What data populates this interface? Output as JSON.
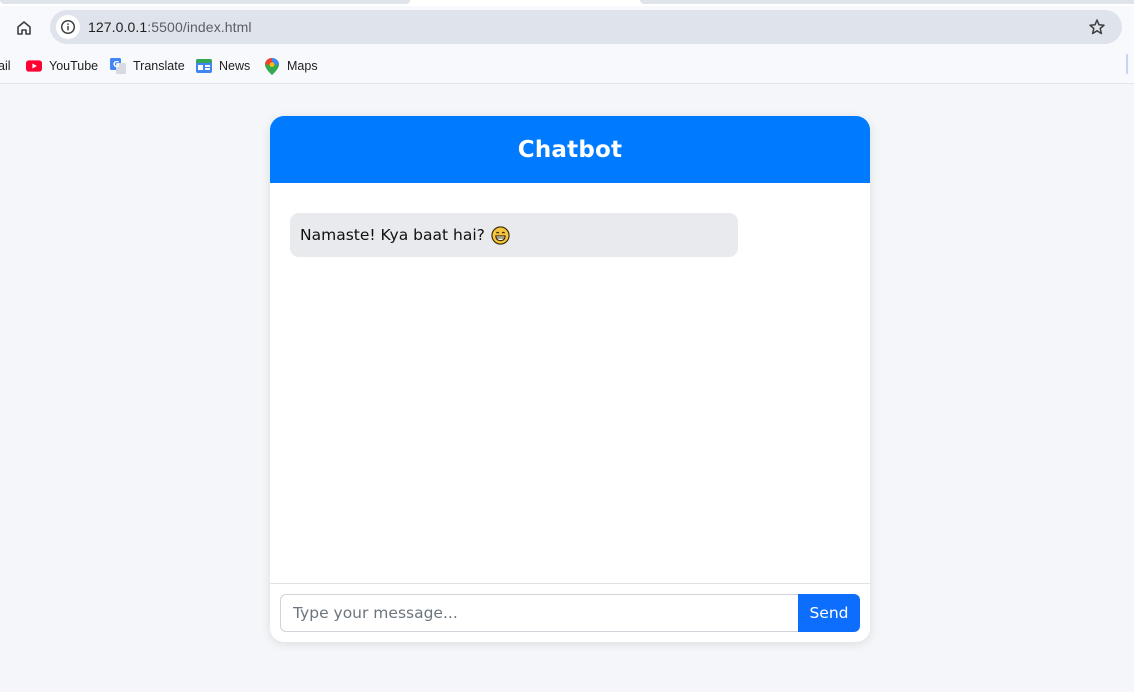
{
  "browser": {
    "url_host": "127.0.0.1",
    "url_path": ":5500/index.html",
    "bookmarks": [
      {
        "label": "ail",
        "icon": "gmail-icon"
      },
      {
        "label": "YouTube",
        "icon": "youtube-icon"
      },
      {
        "label": "Translate",
        "icon": "translate-icon"
      },
      {
        "label": "News",
        "icon": "news-icon"
      },
      {
        "label": "Maps",
        "icon": "maps-icon"
      }
    ]
  },
  "chat": {
    "title": "Chatbot",
    "messages": [
      {
        "sender": "bot",
        "text": "Namaste! Kya baat hai?",
        "emoji": "grinning-face-icon"
      }
    ],
    "input_placeholder": "Type your message...",
    "input_value": "",
    "send_label": "Send"
  },
  "colors": {
    "header": "#007bff",
    "send_button": "#0d6efd",
    "bot_bubble": "#e8eaed",
    "page_bg": "#f4f6f9"
  }
}
